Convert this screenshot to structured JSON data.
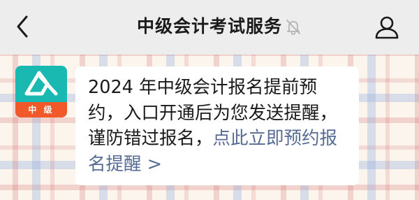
{
  "header": {
    "title": "中级会计考试服务"
  },
  "colors": {
    "accent_link": "#576b95",
    "avatar_teal": "#19b8b0",
    "avatar_badge": "#f2592a"
  },
  "icons": {
    "back": "chevron-left-icon",
    "mute": "bell-off-icon",
    "profile": "person-icon"
  },
  "message": {
    "avatar_badge": "中 级",
    "text": "2024 年中级会计报名提前预约，入口开通后为您发送提醒，谨防错过报名，",
    "link": "点此立即预约报名提醒 >"
  }
}
